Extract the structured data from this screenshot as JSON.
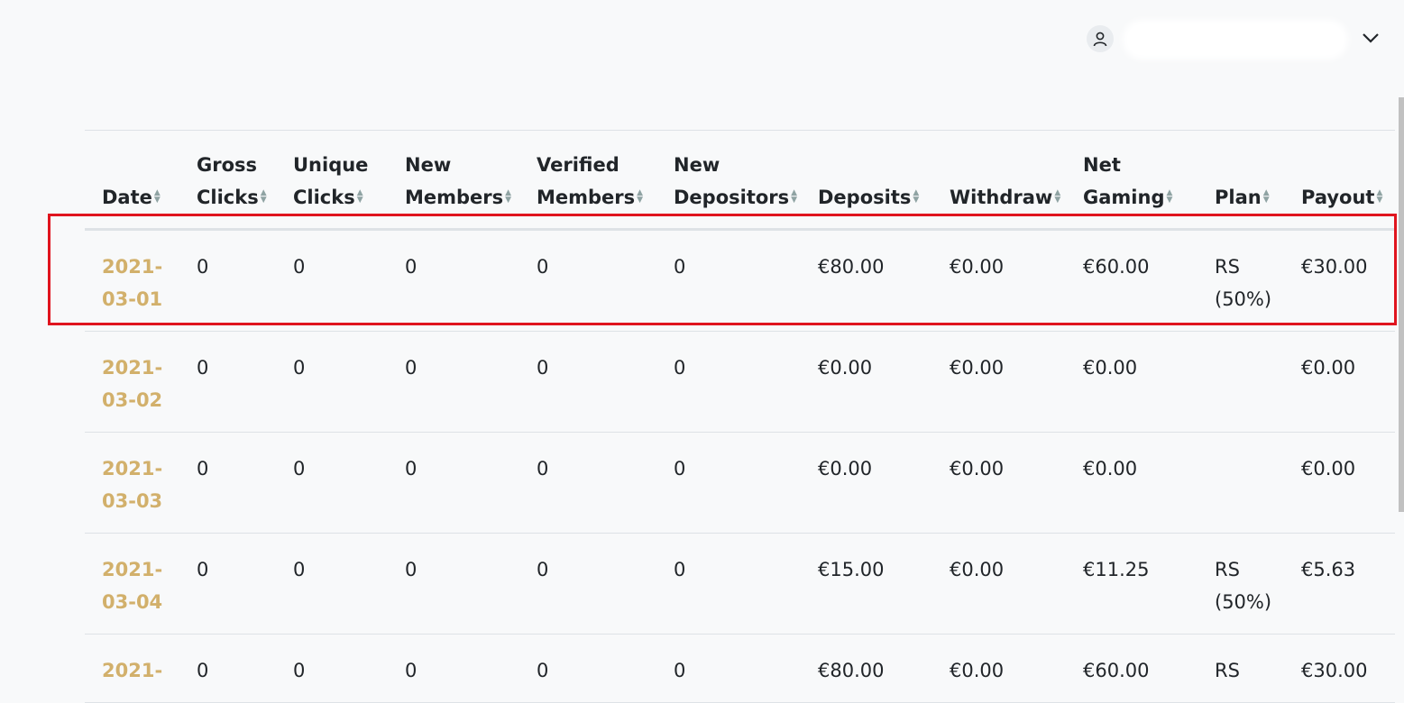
{
  "header": {
    "user_icon": "user-icon",
    "dropdown_icon": "chevron-down-icon"
  },
  "table": {
    "sort_icon": "sort-icon",
    "columns": [
      {
        "label": "Date"
      },
      {
        "label": "Gross Clicks"
      },
      {
        "label": "Unique Clicks"
      },
      {
        "label": "New Members"
      },
      {
        "label": "Verified Members"
      },
      {
        "label": "New Depositors"
      },
      {
        "label": "Deposits"
      },
      {
        "label": "Withdraw"
      },
      {
        "label": "Net Gaming"
      },
      {
        "label": "Plan"
      },
      {
        "label": "Payout"
      }
    ],
    "rows": [
      {
        "date": "2021-03-01",
        "gross_clicks": "0",
        "unique_clicks": "0",
        "new_members": "0",
        "verified_members": "0",
        "new_depositors": "0",
        "deposits": "€80.00",
        "withdraw": "€0.00",
        "net_gaming": "€60.00",
        "plan": "RS (50%)",
        "payout": "€30.00"
      },
      {
        "date": "2021-03-02",
        "gross_clicks": "0",
        "unique_clicks": "0",
        "new_members": "0",
        "verified_members": "0",
        "new_depositors": "0",
        "deposits": "€0.00",
        "withdraw": "€0.00",
        "net_gaming": "€0.00",
        "plan": "",
        "payout": "€0.00"
      },
      {
        "date": "2021-03-03",
        "gross_clicks": "0",
        "unique_clicks": "0",
        "new_members": "0",
        "verified_members": "0",
        "new_depositors": "0",
        "deposits": "€0.00",
        "withdraw": "€0.00",
        "net_gaming": "€0.00",
        "plan": "",
        "payout": "€0.00"
      },
      {
        "date": "2021-03-04",
        "gross_clicks": "0",
        "unique_clicks": "0",
        "new_members": "0",
        "verified_members": "0",
        "new_depositors": "0",
        "deposits": "€15.00",
        "withdraw": "€0.00",
        "net_gaming": "€11.25",
        "plan": "RS (50%)",
        "payout": "€5.63"
      },
      {
        "date": "2021-",
        "gross_clicks": "0",
        "unique_clicks": "0",
        "new_members": "0",
        "verified_members": "0",
        "new_depositors": "0",
        "deposits": "€80.00",
        "withdraw": "€0.00",
        "net_gaming": "€60.00",
        "plan": "RS",
        "payout": "€30.00"
      }
    ]
  },
  "colors": {
    "date_link": "#d2b06b",
    "highlight_border": "#e0141e",
    "sort_icon": "#8fa3a3"
  }
}
